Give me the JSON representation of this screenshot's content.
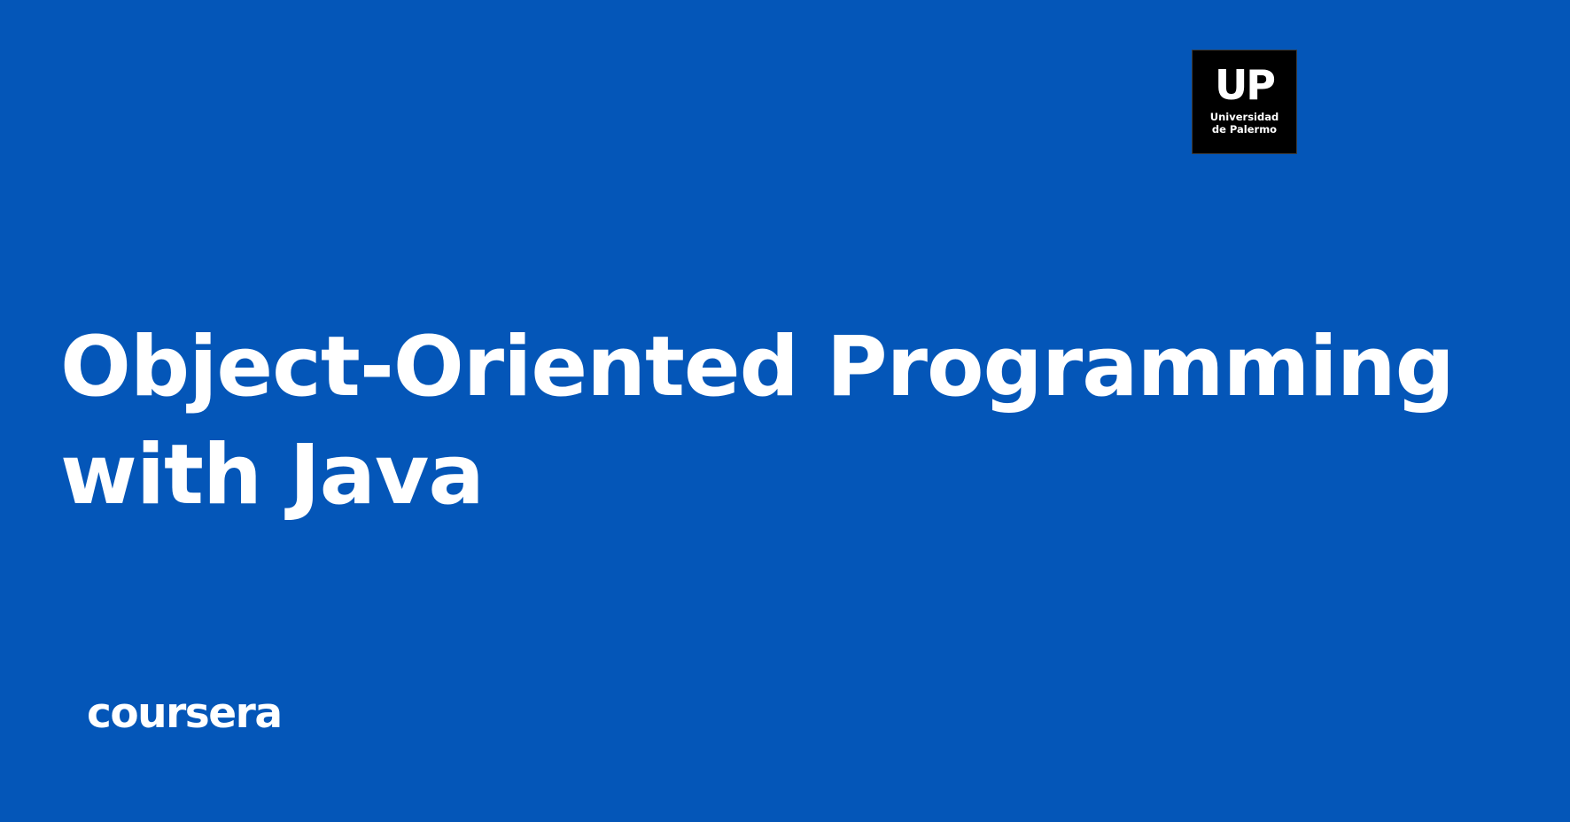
{
  "colors": {
    "background": "#0456b8",
    "text": "#ffffff",
    "logo_background": "#000000"
  },
  "partner_logo": {
    "mark": "UP",
    "name": "Universidad\nde Palermo"
  },
  "course": {
    "title_line1": "Object-Oriented Programming",
    "title_line2": "with Java"
  },
  "brand": {
    "wordmark": "coursera"
  }
}
